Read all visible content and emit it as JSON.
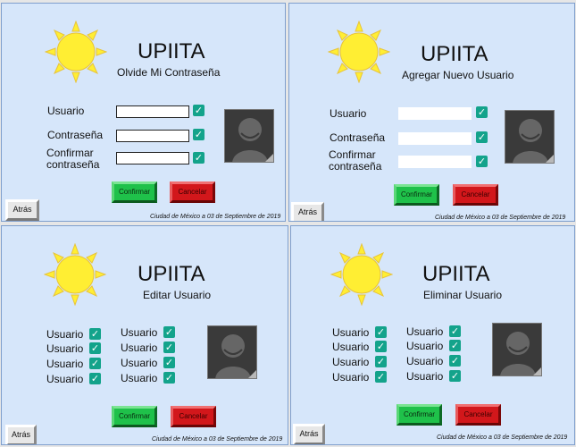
{
  "colors": {
    "panel_bg": "#d6e6fa",
    "check": "#13a38b",
    "confirm": "#1fc14a",
    "cancel": "#d2171b",
    "sun": "#ffee33"
  },
  "panels": [
    {
      "title": "UPIITA",
      "subtitle": "Olvide Mi Contraseña",
      "labels": [
        "Usuario",
        "Contraseña",
        "Confirmar",
        "contraseña"
      ],
      "confirm": "Confirmar",
      "cancel": "Cancelar",
      "back": "Atrás",
      "footer": "Ciudad de México a 03 de Septiembre de 2019"
    },
    {
      "title": "UPIITA",
      "subtitle": "Agregar Nuevo Usuario",
      "labels": [
        "Usuario",
        "Contraseña",
        "Confirmar",
        "contraseña"
      ],
      "confirm": "Confirmar",
      "cancel": "Cancelar",
      "back": "Atrás",
      "footer": "Ciudad de México a 03 de Septiembre de 2019"
    },
    {
      "title": "UPIITA",
      "subtitle": "Editar Usuario",
      "user_items": [
        "Usuario",
        "Usuario",
        "Usuario",
        "Usuario",
        "Usuario",
        "Usuario",
        "Usuario",
        "Usuario"
      ],
      "confirm": "Confirmar",
      "cancel": "Cancelar",
      "back": "Atrás",
      "footer": "Ciudad de México a 03 de Septiembre de 2019"
    },
    {
      "title": "UPIITA",
      "subtitle": "Eliminar Usuario",
      "user_items": [
        "Usuario",
        "Usuario",
        "Usuario",
        "Usuario",
        "Usuario",
        "Usuario",
        "Usuario",
        "Usuario"
      ],
      "confirm": "Confirmar",
      "cancel": "Cancelar",
      "back": "Atrás",
      "footer": "Ciudad de México a 03 de Septiembre de 2019"
    }
  ]
}
